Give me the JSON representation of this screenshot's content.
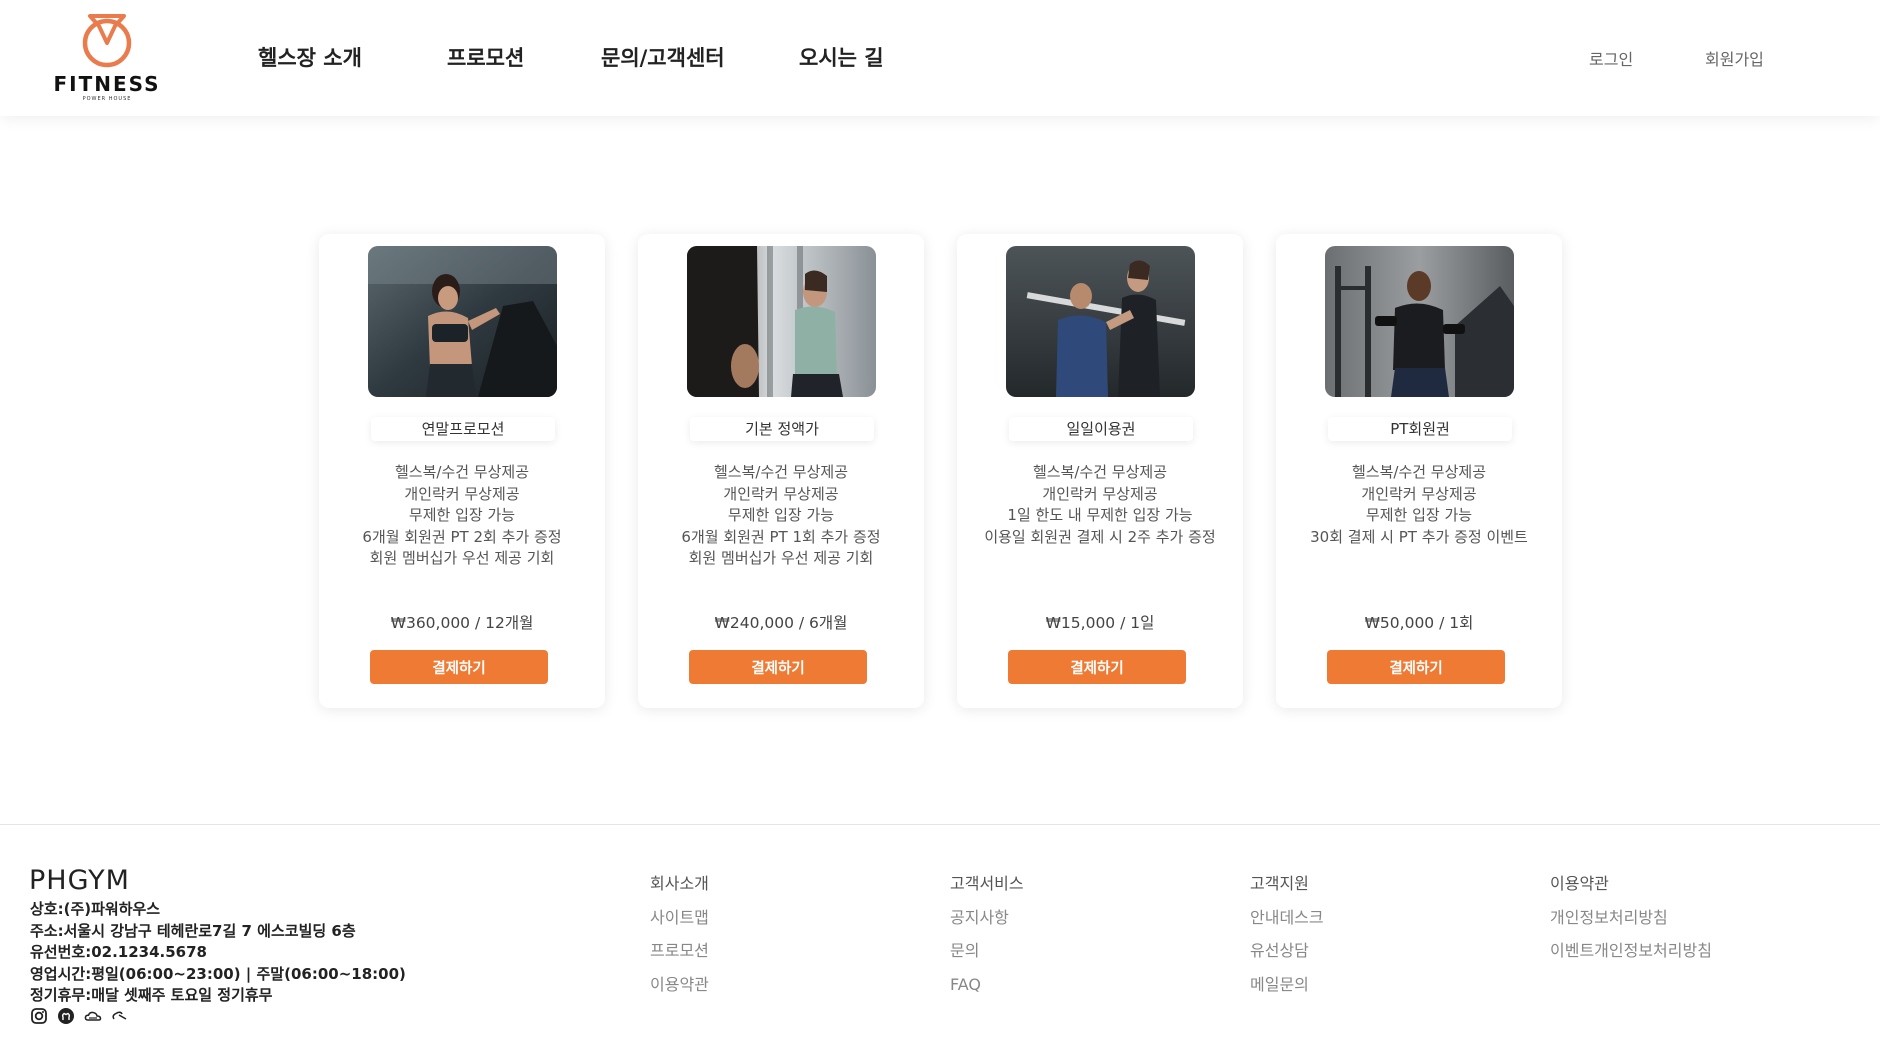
{
  "header": {
    "logo_text": "FITNESS",
    "logo_sub": "POWER HOUSE",
    "nav": [
      "헬스장 소개",
      "프로모션",
      "문의/고객센터",
      "오시는 길"
    ],
    "login": "로그인",
    "signup": "회원가입"
  },
  "colors": {
    "accent": "#ef7a33",
    "logo": "#ea7b4d"
  },
  "cards": [
    {
      "title": "연말프로모션",
      "features": [
        "헬스복/수건 무상제공",
        "개인락커 무상제공",
        "무제한 입장 가능",
        "6개월 회원권 PT 2회 추가 증정",
        "회원 멤버십가 우선 제공 기회"
      ],
      "price": "₩360,000 / 12개월",
      "button": "결제하기"
    },
    {
      "title": "기본 정액가",
      "features": [
        "헬스복/수건 무상제공",
        "개인락커 무상제공",
        "무제한 입장 가능",
        "6개월 회원권 PT 1회 추가 증정",
        "회원 멤버십가 우선 제공 기회"
      ],
      "price": "₩240,000 / 6개월",
      "button": "결제하기"
    },
    {
      "title": "일일이용권",
      "features": [
        "헬스복/수건 무상제공",
        "개인락커 무상제공",
        "1일 한도 내 무제한 입장 가능",
        "이용일 회원권 결제 시 2주 추가 증정"
      ],
      "price": "₩15,000 / 1일",
      "button": "결제하기"
    },
    {
      "title": "PT회원권",
      "features": [
        "헬스복/수건 무상제공",
        "개인락커 무상제공",
        "무제한 입장 가능",
        "30회 결제 시 PT 추가 증정 이벤트"
      ],
      "price": "₩50,000 / 1회",
      "button": "결제하기"
    }
  ],
  "footer": {
    "brand": "PHGYM",
    "info": [
      "상호:(주)파워하우스",
      "주소:서울시 강남구 테헤란로7길 7 에스코빌딩 6층",
      "유선번호:02.1234.5678",
      "영업시간:평일(06:00~23:00) | 주말(06:00~18:00)",
      "정기휴무:매달 셋째주 토요일 정기휴무"
    ],
    "socials": [
      "instagram-icon",
      "github-icon",
      "cloud-icon",
      "link-icon"
    ],
    "columns": [
      [
        "회사소개",
        "사이트맵",
        "프로모션",
        "이용약관"
      ],
      [
        "고객서비스",
        "공지사항",
        "문의",
        "FAQ"
      ],
      [
        "고객지원",
        "안내데스크",
        "유선상담",
        "메일문의"
      ],
      [
        "이용약관",
        "개인정보처리방침",
        "이벤트개인정보처리방침"
      ]
    ]
  }
}
